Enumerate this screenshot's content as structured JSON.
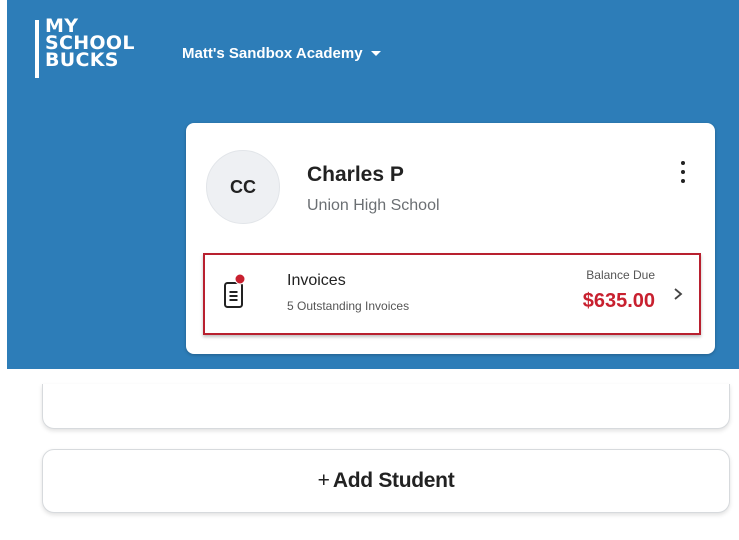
{
  "header": {
    "logo_lines": [
      "MY",
      "SCHOOL",
      "BUCKS"
    ],
    "school_selector": "Matt's Sandbox Academy"
  },
  "student": {
    "initials": "CC",
    "name": "Charles P",
    "school": "Union High School"
  },
  "invoices": {
    "title": "Invoices",
    "subtitle": "5 Outstanding Invoices",
    "balance_label": "Balance Due",
    "balance_amount": "$635.00"
  },
  "add_student": {
    "plus": "+",
    "label": "Add Student"
  },
  "colors": {
    "header_bg": "#2d7db8",
    "alert_red": "#c8202f",
    "highlight_border": "#b8202f"
  }
}
